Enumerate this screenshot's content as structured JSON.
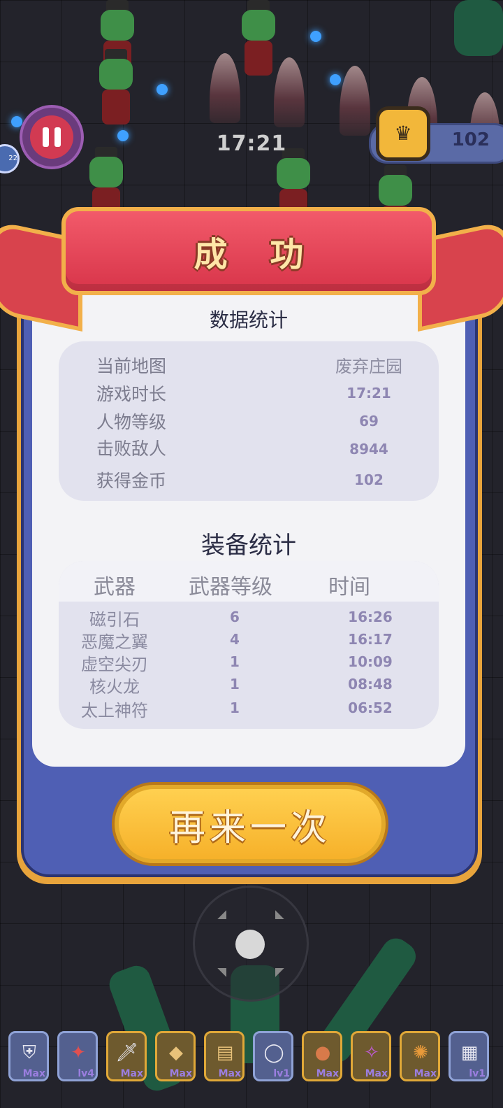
{
  "hud": {
    "timer": "17:21",
    "coins": "102",
    "side_badge": "22"
  },
  "result": {
    "title": "成 功",
    "stats_title": "数据统计",
    "stats": [
      {
        "label": "当前地图",
        "value": "废弃庄园"
      },
      {
        "label": "游戏时长",
        "value": "17:21"
      },
      {
        "label": "人物等级",
        "value": "69"
      },
      {
        "label": "击败敌人",
        "value": "8944"
      },
      {
        "label": "获得金币",
        "value": "102"
      }
    ],
    "equip_title": "装备统计",
    "equip_headers": {
      "weapon": "武器",
      "level": "武器等级",
      "time": "时间"
    },
    "equipment": [
      {
        "name": "磁引石",
        "level": "6",
        "time": "16:26"
      },
      {
        "name": "恶魔之翼",
        "level": "4",
        "time": "16:17"
      },
      {
        "name": "虚空尖刃",
        "level": "1",
        "time": "10:09"
      },
      {
        "name": "核火龙",
        "level": "1",
        "time": "08:48"
      },
      {
        "name": "太上神符",
        "level": "1",
        "time": "06:52"
      }
    ],
    "retry_label": "再来一次"
  },
  "inventory": [
    {
      "icon": "armor-icon",
      "tag": "Max",
      "frame": "blue"
    },
    {
      "icon": "demon-wings-icon",
      "tag": "lv4",
      "frame": "blue"
    },
    {
      "icon": "dagger-icon",
      "tag": "Max",
      "frame": "gold"
    },
    {
      "icon": "bread-icon",
      "tag": "Max",
      "frame": "gold"
    },
    {
      "icon": "scroll-icon",
      "tag": "Max",
      "frame": "gold"
    },
    {
      "icon": "ring-icon",
      "tag": "lv1",
      "frame": "blue"
    },
    {
      "icon": "meat-icon",
      "tag": "Max",
      "frame": "gold"
    },
    {
      "icon": "dragon-icon",
      "tag": "Max",
      "frame": "gold"
    },
    {
      "icon": "sun-amulet-icon",
      "tag": "Max",
      "frame": "gold"
    },
    {
      "icon": "talisman-icon",
      "tag": "lv1",
      "frame": "blue"
    }
  ],
  "colors": {
    "banner": "#d8354a",
    "panel_frame": "#4f5fb4",
    "panel_border": "#e8a43c",
    "retry_button": "#f6b12a",
    "value_text": "#8e86b2"
  }
}
